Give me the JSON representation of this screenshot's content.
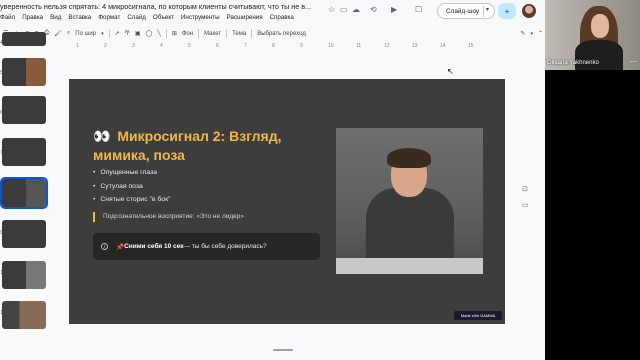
{
  "app": {
    "title": "уверенность нельзя спрятать: 4 микросигнала, по которым клиенты считывают, что ты не в...",
    "menu": [
      "Файл",
      "Правка",
      "Вид",
      "Вставка",
      "Формат",
      "Слайд",
      "Объект",
      "Инструменты",
      "Расширения",
      "Справка"
    ],
    "slideshow_label": "Слайд-шоу",
    "icons": [
      "star-icon",
      "move-to-folder-icon",
      "cloud-status-icon",
      "history-icon",
      "video-call-icon",
      "comment-icon",
      "share-person-icon"
    ]
  },
  "toolbar": {
    "zoom_label": "По шир",
    "background_label": "Фон",
    "layout_label": "Макет",
    "theme_label": "Тема",
    "transition_label": "Выбрать переход"
  },
  "ruler": [
    "1",
    "2",
    "3",
    "4",
    "5",
    "6",
    "7",
    "8",
    "9",
    "10",
    "11",
    "12",
    "13",
    "14",
    "15"
  ],
  "thumbnails": [
    {
      "num": "4"
    },
    {
      "num": "5"
    },
    {
      "num": "6"
    },
    {
      "num": "7"
    },
    {
      "num": "8"
    },
    {
      "num": "9"
    },
    {
      "num": "10"
    },
    {
      "num": "11"
    }
  ],
  "slide": {
    "emoji": "👀",
    "heading": "Микросигнал 2: Взгляд, мимика, поза",
    "bullets": [
      "Опущенные глаза",
      "Сутулая поза",
      "Снятые сторис \"в бок\""
    ],
    "quote": "Подсознательное восприятие: «Это не лидер»",
    "callout_emoji": "📌",
    "callout_bold": "Сними себя 10 сек",
    "callout_rest": " — ты бы себе доверилась?",
    "badge": "Made with GAMMA"
  },
  "video": {
    "name": "Oksana Yakhnenko"
  },
  "colors": {
    "accent": "#f0b84a",
    "slide_bg": "#3d3d3d",
    "primary_blue": "#0b57d0"
  }
}
